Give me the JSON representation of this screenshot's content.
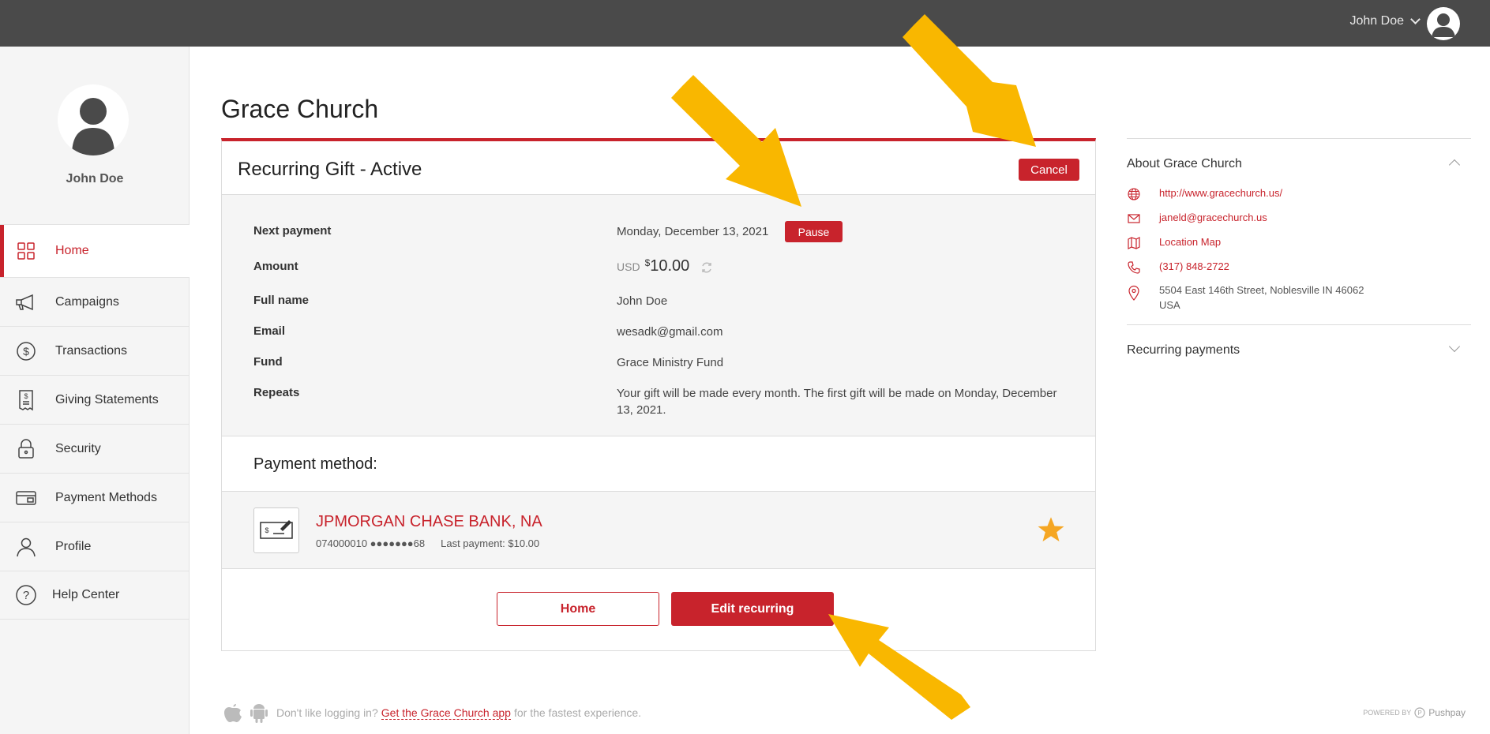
{
  "topbar": {
    "user_name": "John Doe"
  },
  "sidebar": {
    "user_name": "John Doe",
    "items": [
      {
        "label": "Home",
        "icon": "grid-icon"
      },
      {
        "label": "Campaigns",
        "icon": "megaphone-icon"
      },
      {
        "label": "Transactions",
        "icon": "dollar-circle-icon"
      },
      {
        "label": "Giving Statements",
        "icon": "receipt-icon"
      },
      {
        "label": "Security",
        "icon": "lock-icon"
      },
      {
        "label": "Payment Methods",
        "icon": "card-icon"
      },
      {
        "label": "Profile",
        "icon": "person-icon"
      },
      {
        "label": "Help Center",
        "icon": "help-circle-icon"
      }
    ]
  },
  "page": {
    "title": "Grace Church"
  },
  "gift": {
    "title": "Recurring Gift - Active",
    "cancel_label": "Cancel",
    "pause_label": "Pause",
    "rows": {
      "next_payment": {
        "label": "Next payment",
        "value": "Monday, December 13, 2021"
      },
      "amount": {
        "label": "Amount",
        "currency": "USD",
        "symbol": "$",
        "value": "10.00"
      },
      "full_name": {
        "label": "Full name",
        "value": "John Doe"
      },
      "email": {
        "label": "Email",
        "value": "wesadk@gmail.com"
      },
      "fund": {
        "label": "Fund",
        "value": "Grace Ministry Fund"
      },
      "repeats": {
        "label": "Repeats",
        "value": "Your gift will be made every month. The first gift will be made on Monday, December 13, 2021."
      }
    }
  },
  "payment_method": {
    "title": "Payment method:",
    "bank_name": "JPMORGAN CHASE BANK, NA",
    "account": "074000010 ●●●●●●●68",
    "last_payment": "Last payment: $10.00"
  },
  "actions": {
    "home_label": "Home",
    "edit_label": "Edit recurring"
  },
  "about": {
    "title": "About Grace Church",
    "website": "http://www.gracechurch.us/",
    "email": "janeld@gracechurch.us",
    "map": "Location Map",
    "phone": "(317) 848-2722",
    "address_line1": "5504 East 146th Street, Noblesville IN 46062",
    "address_line2": "USA"
  },
  "recurring": {
    "title": "Recurring payments"
  },
  "footer": {
    "prefix": "Don't like logging in?",
    "link": "Get the Grace Church app",
    "suffix": "for the fastest experience.",
    "powered_by": "POWERED BY",
    "brand": "Pushpay"
  },
  "colors": {
    "accent": "#c8232c",
    "topbar": "#4a4a4a",
    "annotation": "#f9b700"
  }
}
